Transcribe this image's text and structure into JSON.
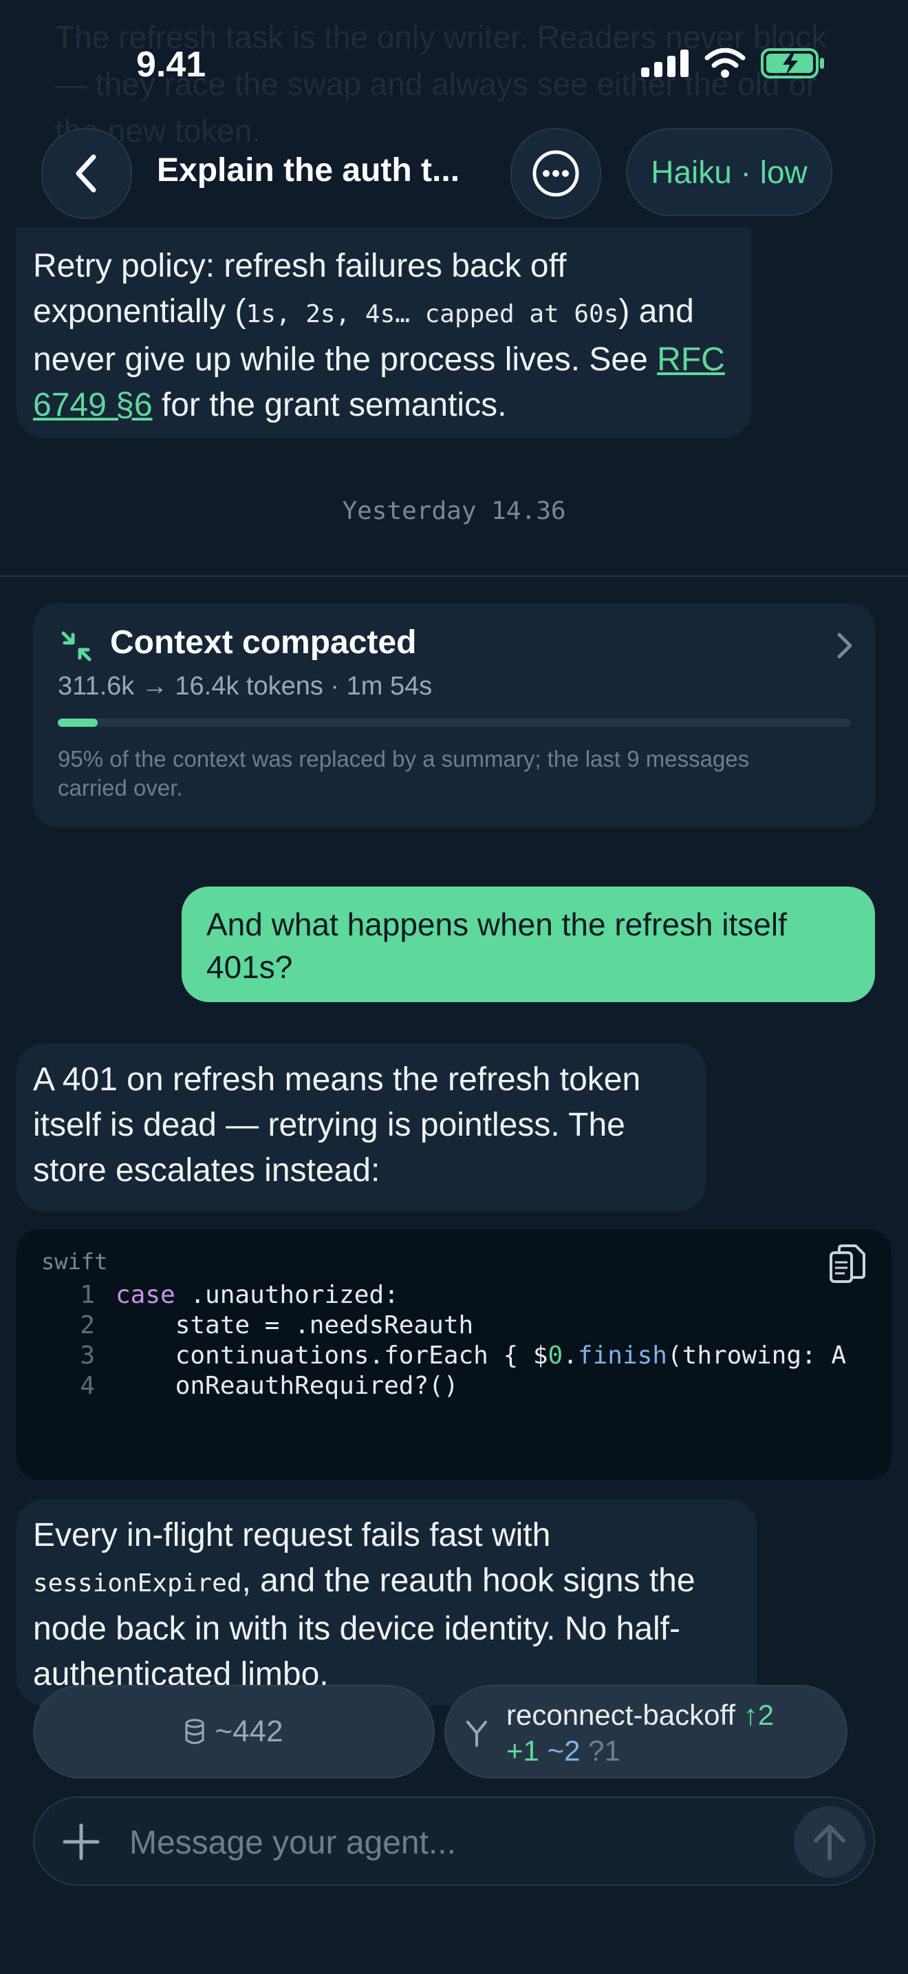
{
  "background_text": "The refresh task is the only writer. Readers never block — they race the swap and always see either the old or the new token.",
  "status": {
    "time": "9.41"
  },
  "header": {
    "title": "Explain the auth t...",
    "model": "Haiku · low"
  },
  "messages": {
    "retry": {
      "t1": "Retry policy: refresh failures back off exponentially (",
      "code": "1s, 2s, 4s… capped at 60s",
      "t2": ") and never give up while the process lives. See ",
      "link": "RFC 6749 §6",
      "t3": " for the grant semantics."
    },
    "timestamp": "Yesterday 14.36",
    "compaction": {
      "title": "Context compacted",
      "subtitle": "311.6k → 16.4k tokens · 1m 54s",
      "progress": 0.05,
      "note": "95% of the context was replaced by a summary; the last 9 messages carried over."
    },
    "user": "And what happens when the refresh itself 401s?",
    "reply1": "A 401 on refresh means the refresh token itself is dead — retrying is pointless. The store escalates instead:",
    "codeblock": {
      "language": "swift",
      "lines": [
        {
          "n": "1",
          "parts": [
            {
              "t": "case",
              "c": "kw"
            },
            {
              "t": " .unauthorized:",
              "c": ""
            }
          ]
        },
        {
          "n": "2",
          "parts": [
            {
              "t": "    state = .needsReauth",
              "c": ""
            }
          ]
        },
        {
          "n": "3",
          "parts": [
            {
              "t": "    continuations.forEach { $",
              "c": ""
            },
            {
              "t": "0",
              "c": "num"
            },
            {
              "t": ".",
              "c": ""
            },
            {
              "t": "finish",
              "c": "fn"
            },
            {
              "t": "(throwing: A",
              "c": ""
            }
          ]
        },
        {
          "n": "4",
          "parts": [
            {
              "t": "    onReauthRequired?()",
              "c": ""
            }
          ]
        }
      ]
    },
    "reply2": {
      "t1": "Every in-flight request fails fast with ",
      "code": "sessionExpired",
      "t2": ", and the reauth hook signs the node back in with its device identity. No half-authenticated limbo."
    }
  },
  "chips": {
    "tokens": "~442",
    "branch": {
      "name": "reconnect-backoff",
      "ahead": "↑2",
      "added": "+1",
      "modified": "~2",
      "untracked": "?1"
    }
  },
  "composer": {
    "placeholder": "Message your agent..."
  },
  "colors": {
    "accent": "#5fd89b",
    "background": "#0f1b29",
    "bubble": "#172637"
  }
}
